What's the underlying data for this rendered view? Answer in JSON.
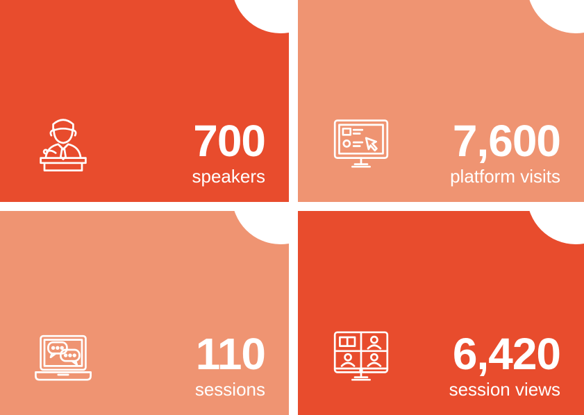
{
  "colors": {
    "dark_tile": "#e84c2d",
    "light_tile": "#ef9472"
  },
  "tiles": [
    {
      "number": "700",
      "label": "speakers",
      "icon": "speaker-at-podium-icon",
      "shade": "dark"
    },
    {
      "number": "7,600",
      "label": "platform visits",
      "icon": "monitor-dashboard-icon",
      "shade": "light"
    },
    {
      "number": "110",
      "label": "sessions",
      "icon": "laptop-chat-icon",
      "shade": "light"
    },
    {
      "number": "6,420",
      "label": "session views",
      "icon": "video-conference-icon",
      "shade": "dark"
    }
  ]
}
